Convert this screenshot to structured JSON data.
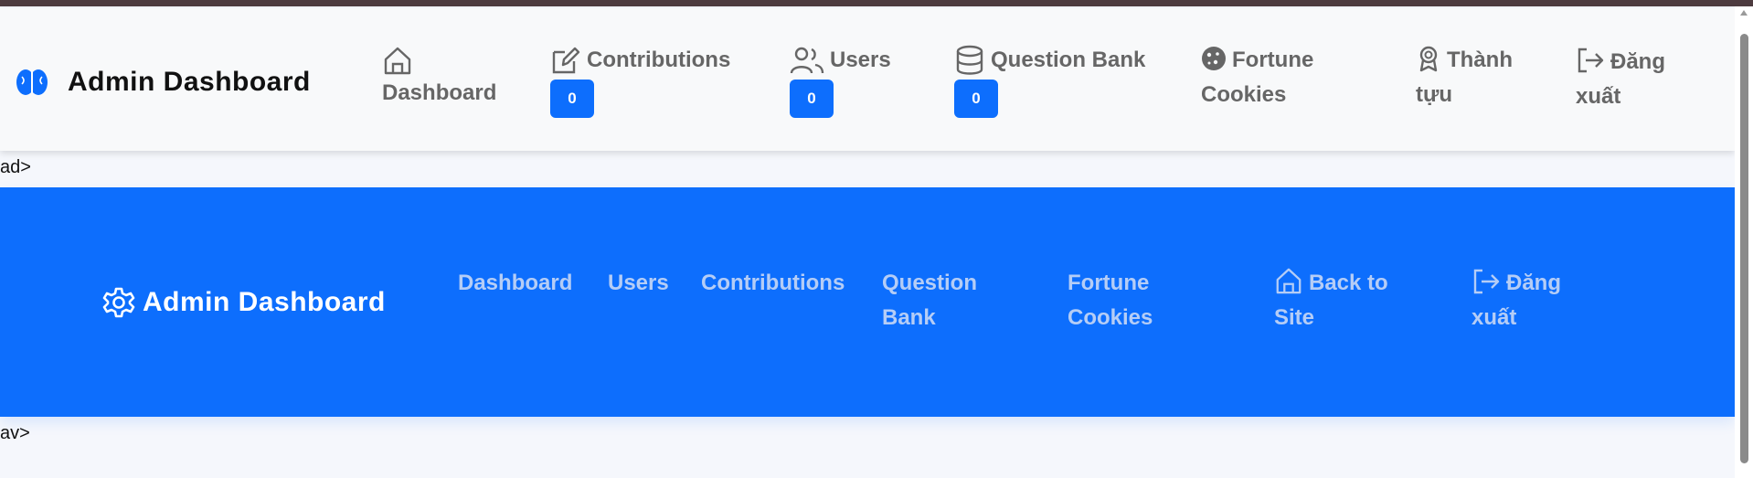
{
  "top_nav": {
    "brand": "Admin Dashboard",
    "items": [
      {
        "label": "Dashboard",
        "icon": "house-icon"
      },
      {
        "label": "Contributions",
        "icon": "pencil-square-icon",
        "badge": "0"
      },
      {
        "label": "Users",
        "icon": "people-icon",
        "badge": "0"
      },
      {
        "label": "Question Bank",
        "icon": "database-icon",
        "badge": "0"
      },
      {
        "label": "Fortune Cookies",
        "icon": "cookie-icon"
      },
      {
        "label": "Thành tựu",
        "icon": "award-icon"
      },
      {
        "label": "Đăng xuất",
        "icon": "logout-icon"
      }
    ]
  },
  "stray_text": {
    "line1": "ad>",
    "line2": "av>"
  },
  "admin_nav": {
    "brand": "Admin Dashboard",
    "brand_icon": "gear-icon",
    "items": [
      {
        "label": "Dashboard"
      },
      {
        "label": "Users"
      },
      {
        "label": "Contributions"
      },
      {
        "label": "Question Bank"
      },
      {
        "label": "Fortune Cookies"
      },
      {
        "label": "Back to Site",
        "icon": "house-icon"
      },
      {
        "label": "Đăng xuất",
        "icon": "logout-icon"
      }
    ]
  },
  "colors": {
    "primary": "#0d6efd",
    "muted_text": "#666666",
    "nav_link_light": "#b5cdf6"
  }
}
